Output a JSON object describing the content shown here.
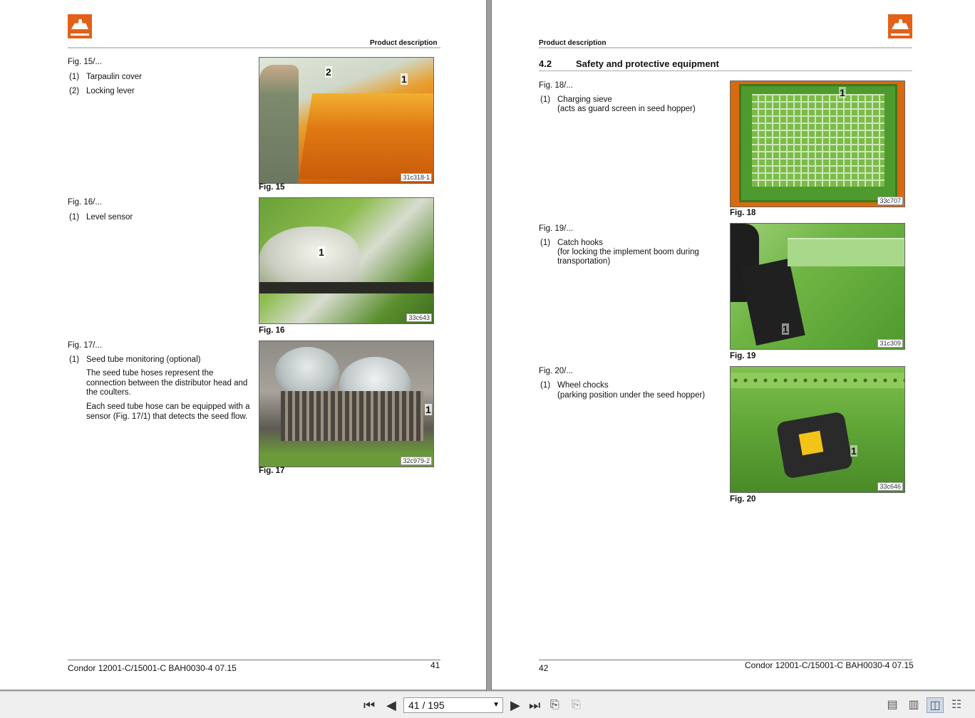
{
  "left_page": {
    "header": "Product description",
    "figures": [
      {
        "ref": "Fig. 15/...",
        "items": [
          {
            "num": "(1)",
            "label": "Tarpaulin cover"
          },
          {
            "num": "(2)",
            "label": "Locking lever"
          }
        ],
        "caption": "Fig. 15",
        "code": "31c318-1",
        "callouts": [
          "2",
          "1"
        ]
      },
      {
        "ref": "Fig. 16/...",
        "items": [
          {
            "num": "(1)",
            "label": "Level sensor"
          }
        ],
        "caption": "Fig. 16",
        "code": "33c643",
        "callouts": [
          "1"
        ]
      },
      {
        "ref": "Fig. 17/...",
        "items": [
          {
            "num": "(1)",
            "label": "Seed tube monitoring (optional)"
          }
        ],
        "paragraphs": [
          "The seed tube hoses represent the connection between the distributor head and the coulters.",
          "Each seed tube hose can be equipped with a sensor (Fig. 17/1) that detects the seed flow."
        ],
        "caption": "Fig. 17",
        "code": "32c979-2",
        "callouts": [
          "1"
        ]
      }
    ],
    "footer_left": "Condor 12001-C/15001-C  BAH0030-4  07.15",
    "page_number": "41"
  },
  "right_page": {
    "header": "Product description",
    "section_number": "4.2",
    "section_title": "Safety and protective equipment",
    "figures": [
      {
        "ref": "Fig. 18/...",
        "items": [
          {
            "num": "(1)",
            "label": "Charging sieve",
            "sub": "(acts as guard screen in seed hopper)"
          }
        ],
        "caption": "Fig. 18",
        "code": "33c707",
        "callouts": [
          "1"
        ]
      },
      {
        "ref": "Fig. 19/...",
        "items": [
          {
            "num": "(1)",
            "label": "Catch hooks",
            "sub": "(for locking the implement boom during",
            "sub2": "transportation)"
          }
        ],
        "caption": "Fig. 19",
        "code": "31c309",
        "callouts": [
          "1"
        ]
      },
      {
        "ref": "Fig. 20/...",
        "items": [
          {
            "num": "(1)",
            "label": "Wheel chocks",
            "sub": "(parking position under the seed hopper)"
          }
        ],
        "caption": "Fig. 20",
        "code": "33c646",
        "callouts": [
          "1"
        ]
      }
    ],
    "page_number": "42",
    "footer_right": "Condor 12001-C/15001-C  BAH0030-4  07.15"
  },
  "toolbar": {
    "first_icon": "first-page-icon",
    "prev_icon": "previous-page-icon",
    "page_value": "41 / 195",
    "next_icon": "next-page-icon",
    "last_icon": "last-page-icon",
    "colors": {
      "accent": "#e2611a",
      "active_view": "#cfd9e6"
    }
  }
}
